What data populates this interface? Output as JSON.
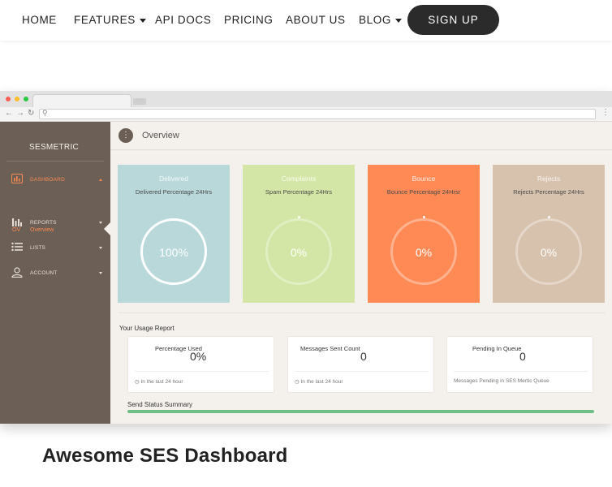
{
  "nav": {
    "items": [
      {
        "label": "HOME"
      },
      {
        "label": "FEATURES",
        "dropdown": true
      },
      {
        "label": "API DOCS"
      },
      {
        "label": "PRICING"
      },
      {
        "label": "ABOUT US"
      },
      {
        "label": "BLOG",
        "dropdown": true
      }
    ],
    "signup_label": "SIGN UP"
  },
  "dashboard": {
    "brand": "SESMETRIC",
    "sidebar": {
      "items": [
        {
          "label": "DASHBOARD",
          "icon": "bar-chart-icon",
          "active": true
        },
        {
          "label": "REPORTS",
          "icon": "reports-icon"
        },
        {
          "label": "LISTS",
          "icon": "list-icon"
        },
        {
          "label": "ACCOUNT",
          "icon": "user-icon"
        }
      ],
      "sub_item": {
        "abbr": "OV",
        "label": "Overview"
      }
    },
    "overview": {
      "title": "Overview",
      "icon": "more-vertical-icon"
    },
    "stats": [
      {
        "title": "Delivered",
        "subtitle": "Delivered Percentage 24Hrs",
        "value": "100%",
        "percent": 100,
        "color": "#b9d8da"
      },
      {
        "title": "Complaints",
        "subtitle": "Spam Percentage 24Hrs",
        "value": "0%",
        "percent": 0,
        "color": "#d3e6a5"
      },
      {
        "title": "Bounce",
        "subtitle": "Bounce Percentage 24Hrsr",
        "value": "0%",
        "percent": 0,
        "color": "#ff8a56"
      },
      {
        "title": "Rejects",
        "subtitle": "Rejects Percentage 24Hrs",
        "value": "0%",
        "percent": 0,
        "color": "#d7c2ad"
      }
    ],
    "usage": {
      "title": "Your Usage Report",
      "cards": [
        {
          "label": "Percentage Used",
          "value": "0%",
          "footer": "In the last 24 hour",
          "footer_icon": "clock-icon"
        },
        {
          "label": "Messages Sent Count",
          "value": "0",
          "footer": "In the last 24 hour",
          "footer_icon": "clock-icon"
        },
        {
          "label": "Pending In Queue",
          "value": "0",
          "footer": "Messages Pending in SES Mertic Queue"
        }
      ]
    },
    "send_status_title": "Send Status Summary"
  },
  "heading": "Awesome SES Dashboard"
}
